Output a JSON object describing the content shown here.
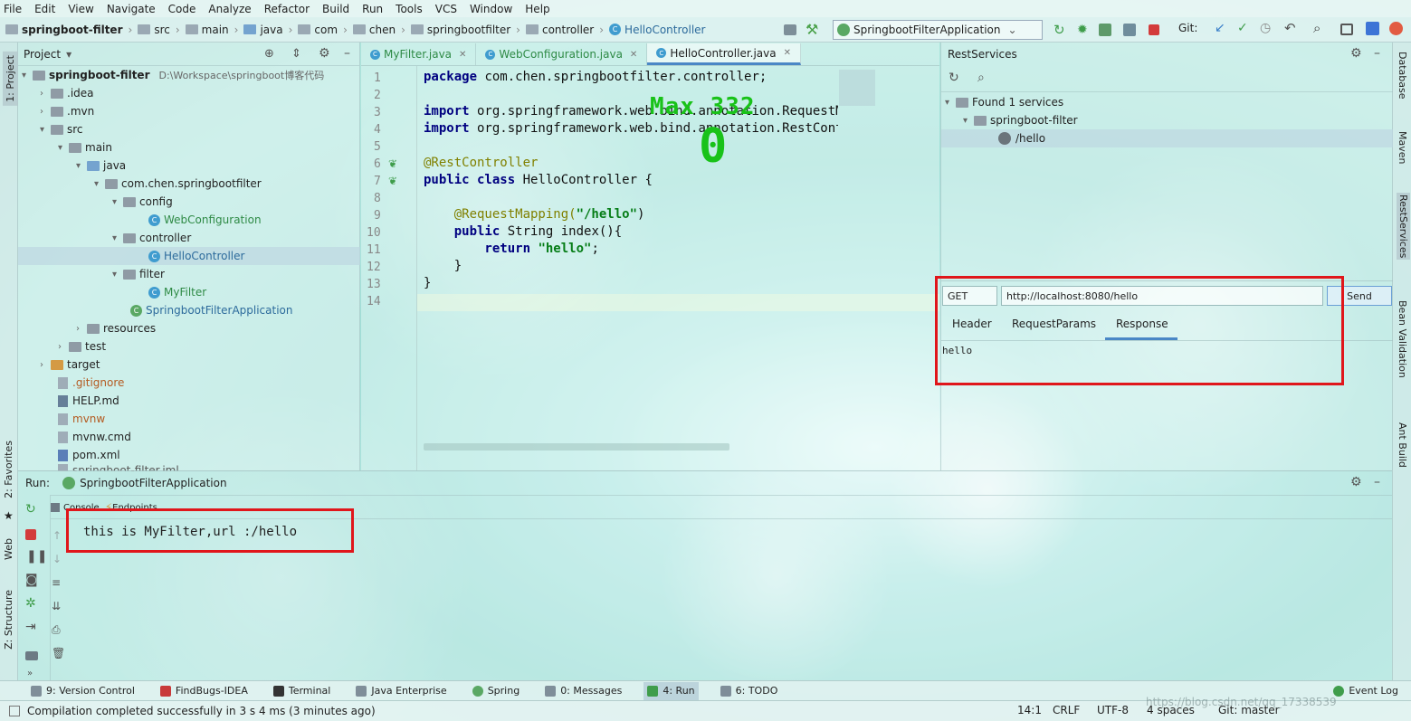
{
  "menu": [
    "File",
    "Edit",
    "View",
    "Navigate",
    "Code",
    "Analyze",
    "Refactor",
    "Build",
    "Run",
    "Tools",
    "VCS",
    "Window",
    "Help"
  ],
  "breadcrumbs": [
    "springboot-filter",
    "src",
    "main",
    "java",
    "com",
    "chen",
    "springbootfilter",
    "controller",
    "HelloController"
  ],
  "run_config": "SpringbootFilterApplication",
  "git_label": "Git:",
  "left_tabs": {
    "project": "1: Project",
    "favorites": "2: Favorites",
    "web": "Web",
    "structure": "Z: Structure"
  },
  "right_tabs": {
    "database": "Database",
    "maven": "Maven",
    "rest": "RestServices",
    "bean": "Bean Validation",
    "ant": "Ant Build"
  },
  "project": {
    "title": "Project",
    "root_name": "springboot-filter",
    "root_path": "D:\\Workspace\\springboot博客代码",
    "items": [
      ".idea",
      ".mvn",
      "src",
      "main",
      "java",
      "com.chen.springbootfilter",
      "config",
      "WebConfiguration",
      "controller",
      "HelloController",
      "filter",
      "MyFilter",
      "SpringbootFilterApplication",
      "resources",
      "test",
      "target",
      ".gitignore",
      "HELP.md",
      "mvnw",
      "mvnw.cmd",
      "pom.xml",
      "springboot-filter.iml"
    ]
  },
  "editor": {
    "tabs": [
      "MyFilter.java",
      "WebConfiguration.java",
      "HelloController.java"
    ],
    "active_tab": 2,
    "line_numbers": [
      "1",
      "2",
      "3",
      "4",
      "5",
      "6",
      "7",
      "8",
      "9",
      "10",
      "11",
      "12",
      "13",
      "14"
    ],
    "code": {
      "l1a": "package",
      "l1b": " com.chen.springbootfilter.controller;",
      "l3a": "import",
      "l3b": " org.springframework.web.bind.annotation.RequestMapping;",
      "l4a": "import",
      "l4b": " org.springframework.web.bind.annotation.RestController;",
      "l6": "@RestController",
      "l7a": "public class",
      "l7b": " HelloController {",
      "l9a": "    @RequestMapping(",
      "l9b": "\"/hello\"",
      "l9c": ")",
      "l10a": "    public",
      "l10b": " String index(){",
      "l11a": "        return",
      "l11b": " \"hello\"",
      "l11c": ";",
      "l12": "    }",
      "l13": "}"
    },
    "overlay_max": "Max 332",
    "overlay_zero": "0"
  },
  "rest": {
    "title": "RestServices",
    "found": "Found 1 services",
    "service": "springboot-filter",
    "endpoint": "/hello",
    "method": "GET",
    "url": "http://localhost:8080/hello",
    "send": "Send",
    "tabs": [
      "Header",
      "RequestParams",
      "Response"
    ],
    "active_tab": 2,
    "response": "hello"
  },
  "run": {
    "label": "Run:",
    "config": "SpringbootFilterApplication",
    "tabs": [
      "Console",
      "Endpoints"
    ],
    "output": "this is MyFilter,url :/hello"
  },
  "toolwindows": [
    "9: Version Control",
    "FindBugs-IDEA",
    "Terminal",
    "Java Enterprise",
    "Spring",
    "0: Messages",
    "4: Run",
    "6: TODO",
    "Event Log"
  ],
  "status": {
    "message": "Compilation completed successfully in 3 s 4 ms (3 minutes ago)",
    "position": "14:1",
    "line_sep": "CRLF",
    "encoding": "UTF-8",
    "indent": "4 spaces",
    "git": "Git: master",
    "watermark": "https://blog.csdn.net/qq_17338539"
  },
  "colors": {
    "highlight_box": "#e0161b",
    "keyword": "#000080",
    "annotation": "#808000",
    "string": "#067d17",
    "overlay": "#19c219"
  }
}
